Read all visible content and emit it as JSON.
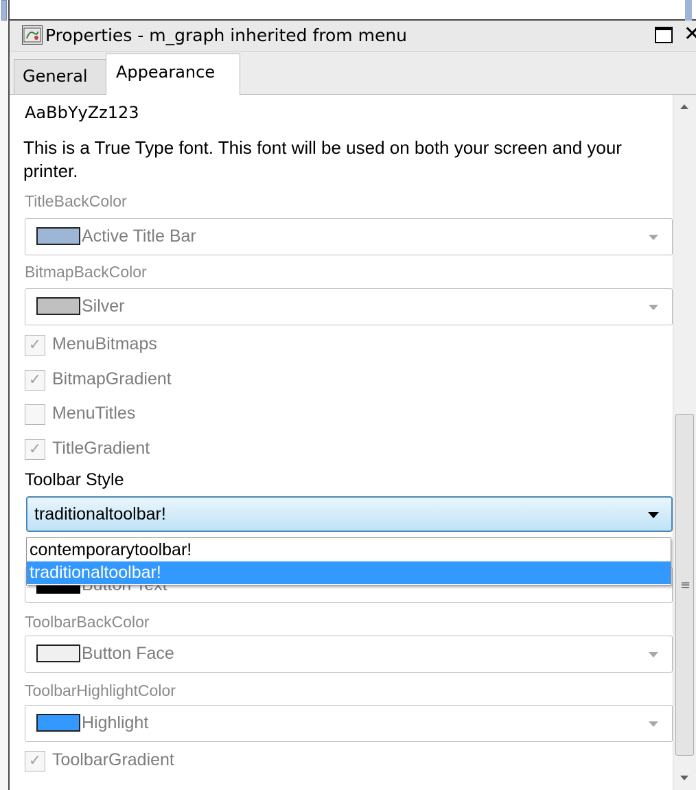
{
  "window": {
    "title": "Properties - m_graph  inherited  from  menu",
    "close_glyph": "✕"
  },
  "tabs": [
    {
      "label": "General",
      "active": false
    },
    {
      "label": "Appearance",
      "active": true
    }
  ],
  "font_preview": {
    "sample": "AaBbYyZz123",
    "description": "This is a True Type font. This font will be used on both your screen and your printer."
  },
  "fields": {
    "title_back_color": {
      "label": "TitleBackColor",
      "value": "Active Title Bar",
      "swatch": "#9eb6d6"
    },
    "bitmap_back_color": {
      "label": "BitmapBackColor",
      "value": "Silver",
      "swatch": "#c0c0c0"
    },
    "toolbar_back_color": {
      "label": "ToolbarBackColor",
      "value": "Button Face",
      "swatch": "#f0f0f0"
    },
    "toolbar_highlight_color": {
      "label": "ToolbarHighlightColor",
      "value": "Highlight",
      "swatch": "#3399ff"
    },
    "toolbar_text_color": {
      "value": "Button Text",
      "swatch": "#000000"
    }
  },
  "checkboxes": [
    {
      "label": "MenuBitmaps",
      "checked": true
    },
    {
      "label": "BitmapGradient",
      "checked": true
    },
    {
      "label": "MenuTitles",
      "checked": false
    },
    {
      "label": "TitleGradient",
      "checked": true
    },
    {
      "label": "ToolbarGradient",
      "checked": true
    }
  ],
  "check_glyph": "✓",
  "toolbar_style": {
    "label": "Toolbar Style",
    "value": "traditionaltoolbar!",
    "options": [
      "contemporarytoolbar!",
      "traditionaltoolbar!"
    ],
    "highlighted_option": "traditionaltoolbar!"
  },
  "scrollbar": {
    "grip_glyph": "≡"
  }
}
